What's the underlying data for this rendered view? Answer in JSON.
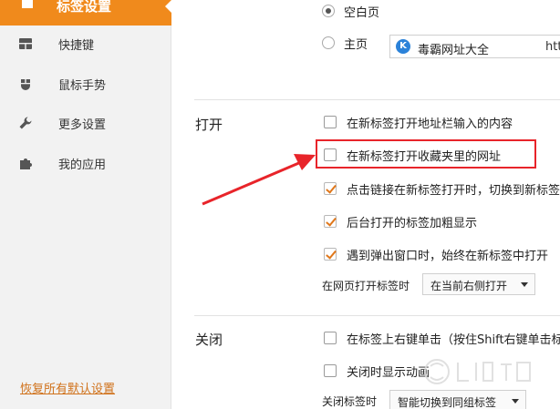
{
  "sidebar": {
    "active_label": "标签设置",
    "items": [
      {
        "label": "快捷键",
        "icon": "keyboard-icon"
      },
      {
        "label": "鼠标手势",
        "icon": "mouse-icon"
      },
      {
        "label": "更多设置",
        "icon": "wrench-icon"
      },
      {
        "label": "我的应用",
        "icon": "puzzle-icon"
      }
    ],
    "restore_label": "恢复所有默认设置"
  },
  "startup": {
    "blank_label": "空白页",
    "home_label": "主页",
    "home_site_name": "毒霸网址大全",
    "home_url": "htt",
    "site_icon_letter": "K"
  },
  "open_section": {
    "title": "打开",
    "options": [
      {
        "label": "在新标签打开地址栏输入的内容",
        "checked": false
      },
      {
        "label": "在新标签打开收藏夹里的网址",
        "checked": false
      },
      {
        "label": "点击链接在新标签打开时，切换到新标签",
        "checked": true
      },
      {
        "label": "后台打开的标签加粗显示",
        "checked": true
      },
      {
        "label": "遇到弹出窗口时，始终在新标签中打开",
        "checked": true
      }
    ],
    "select_label": "在网页打开标签时",
    "select_value": "在当前右侧打开"
  },
  "close_section": {
    "title": "关闭",
    "options": [
      {
        "label": "在标签上右键单击（按住Shift右键单击标",
        "checked": false
      },
      {
        "label": "关闭时显示动画",
        "checked": false
      }
    ],
    "select_label": "关闭标签时",
    "select_value": "智能切换到同组标签"
  },
  "colors": {
    "accent": "#f08a1c",
    "annotation_red": "#e8242a"
  }
}
